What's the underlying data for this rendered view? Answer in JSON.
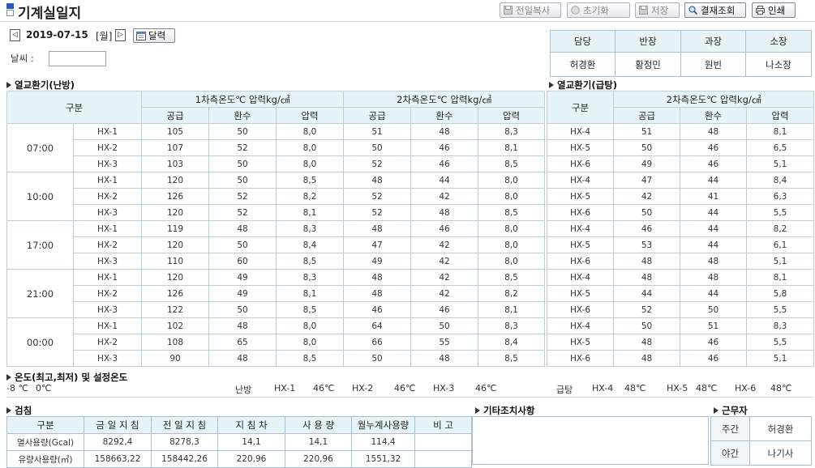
{
  "header": {
    "title": "기계실일지",
    "buttons": {
      "copy_prev": "전일복사",
      "reset": "초기화",
      "save": "저장",
      "approval_view": "결재조회",
      "print": "인쇄"
    }
  },
  "date_row": {
    "date": "2019-07-15",
    "weekday": "[월]",
    "prev": "◁",
    "next": "▷",
    "calendar_label": "달력",
    "weather_label": "날씨 :",
    "weather_value": ""
  },
  "approval": {
    "roles": [
      "담당",
      "반장",
      "과장",
      "소장"
    ],
    "names": [
      "허경환",
      "황정민",
      "원빈",
      "나소장"
    ]
  },
  "heating": {
    "section": "열교환기(난방)",
    "division": "구분",
    "group1": "1차측온도℃ 압력kg/㎠",
    "group2": "2차측온도℃ 압력kg/㎠",
    "cols": [
      "공급",
      "환수",
      "압력",
      "공급",
      "환수",
      "압력"
    ],
    "blocks": [
      {
        "time": "07:00",
        "rows": [
          {
            "hx": "HX-1",
            "v": [
              "105",
              "50",
              "8,0",
              "51",
              "48",
              "8,3"
            ]
          },
          {
            "hx": "HX-2",
            "v": [
              "107",
              "52",
              "8,0",
              "50",
              "46",
              "8,1"
            ]
          },
          {
            "hx": "HX-3",
            "v": [
              "103",
              "50",
              "8,0",
              "52",
              "46",
              "8,5"
            ]
          }
        ]
      },
      {
        "time": "10:00",
        "rows": [
          {
            "hx": "HX-1",
            "v": [
              "120",
              "50",
              "8,5",
              "48",
              "44",
              "8,0"
            ]
          },
          {
            "hx": "HX-2",
            "v": [
              "126",
              "52",
              "8,2",
              "52",
              "42",
              "8,0"
            ]
          },
          {
            "hx": "HX-3",
            "v": [
              "120",
              "52",
              "8,1",
              "52",
              "48",
              "8,5"
            ]
          }
        ]
      },
      {
        "time": "17:00",
        "rows": [
          {
            "hx": "HX-1",
            "v": [
              "119",
              "48",
              "8,3",
              "48",
              "46",
              "8,0"
            ]
          },
          {
            "hx": "HX-2",
            "v": [
              "120",
              "50",
              "8,4",
              "47",
              "42",
              "8,0"
            ]
          },
          {
            "hx": "HX-3",
            "v": [
              "110",
              "60",
              "8,5",
              "49",
              "42",
              "8,0"
            ]
          }
        ]
      },
      {
        "time": "21:00",
        "rows": [
          {
            "hx": "HX-1",
            "v": [
              "120",
              "49",
              "8,3",
              "48",
              "42",
              "8,5"
            ]
          },
          {
            "hx": "HX-2",
            "v": [
              "126",
              "49",
              "8,1",
              "48",
              "42",
              "8,2"
            ]
          },
          {
            "hx": "HX-3",
            "v": [
              "122",
              "50",
              "8,5",
              "46",
              "46",
              "8,1"
            ]
          }
        ]
      },
      {
        "time": "00:00",
        "rows": [
          {
            "hx": "HX-1",
            "v": [
              "102",
              "48",
              "8,0",
              "64",
              "50",
              "8,3"
            ]
          },
          {
            "hx": "HX-2",
            "v": [
              "108",
              "65",
              "8,0",
              "66",
              "55",
              "8,4"
            ]
          },
          {
            "hx": "HX-3",
            "v": [
              "90",
              "48",
              "8,5",
              "50",
              "48",
              "8,5"
            ]
          }
        ]
      }
    ]
  },
  "hotwater": {
    "section": "열교환기(급탕)",
    "division": "구분",
    "group2": "2차측온도℃ 압력kg/㎠",
    "cols": [
      "공급",
      "환수",
      "압력"
    ],
    "blocks": [
      {
        "rows": [
          {
            "hx": "HX-4",
            "v": [
              "51",
              "48",
              "8,1"
            ]
          },
          {
            "hx": "HX-5",
            "v": [
              "50",
              "46",
              "6,5"
            ]
          },
          {
            "hx": "HX-6",
            "v": [
              "49",
              "46",
              "5,1"
            ]
          }
        ]
      },
      {
        "rows": [
          {
            "hx": "HX-4",
            "v": [
              "47",
              "44",
              "8,4"
            ]
          },
          {
            "hx": "HX-5",
            "v": [
              "42",
              "41",
              "6,3"
            ]
          },
          {
            "hx": "HX-6",
            "v": [
              "50",
              "44",
              "5,5"
            ]
          }
        ]
      },
      {
        "rows": [
          {
            "hx": "HX-4",
            "v": [
              "46",
              "44",
              "8,2"
            ]
          },
          {
            "hx": "HX-5",
            "v": [
              "53",
              "44",
              "6,1"
            ]
          },
          {
            "hx": "HX-6",
            "v": [
              "48",
              "48",
              "5,1"
            ]
          }
        ]
      },
      {
        "rows": [
          {
            "hx": "HX-4",
            "v": [
              "48",
              "48",
              "8,1"
            ]
          },
          {
            "hx": "HX-5",
            "v": [
              "44",
              "44",
              "5,8"
            ]
          },
          {
            "hx": "HX-6",
            "v": [
              "52",
              "50",
              "5,5"
            ]
          }
        ]
      },
      {
        "rows": [
          {
            "hx": "HX-4",
            "v": [
              "50",
              "51",
              "8,3"
            ]
          },
          {
            "hx": "HX-5",
            "v": [
              "48",
              "46",
              "5,5"
            ]
          },
          {
            "hx": "HX-6",
            "v": [
              "48",
              "46",
              "5,1"
            ]
          }
        ]
      }
    ]
  },
  "temps": {
    "section": "온도(최고,최저) 및 설정온도",
    "max": "-8 ℃",
    "min": "0℃",
    "heating_label": "난방",
    "heating": [
      {
        "hx": "HX-1",
        "t": "46℃"
      },
      {
        "hx": "HX-2",
        "t": "46℃"
      },
      {
        "hx": "HX-3",
        "t": "46℃"
      }
    ],
    "hotwater_label": "급탕",
    "hotwater": [
      {
        "hx": "HX-4",
        "t": "48℃"
      },
      {
        "hx": "HX-5",
        "t": "48℃"
      },
      {
        "hx": "HX-6",
        "t": "48℃"
      }
    ]
  },
  "inspection": {
    "section": "검침",
    "headers": [
      "구분",
      "금 일 지 침",
      "전 일 지 침",
      "지  침  차",
      "사  용  량",
      "월누계사용량",
      "비    고"
    ],
    "rows": [
      {
        "label": "열사용량(Gcal)",
        "v": [
          "8292,4",
          "8278,3",
          "14,1",
          "14,1",
          "114,4",
          ""
        ]
      },
      {
        "label": "유량사용량(㎥)",
        "v": [
          "158663,22",
          "158442,26",
          "220,96",
          "220,96",
          "1551,32",
          ""
        ]
      }
    ]
  },
  "other": {
    "section": "기타조치사항"
  },
  "workers": {
    "section": "근무자",
    "rows": [
      {
        "shift": "주간",
        "name": "허경환"
      },
      {
        "shift": "야간",
        "name": "나기사"
      }
    ]
  }
}
